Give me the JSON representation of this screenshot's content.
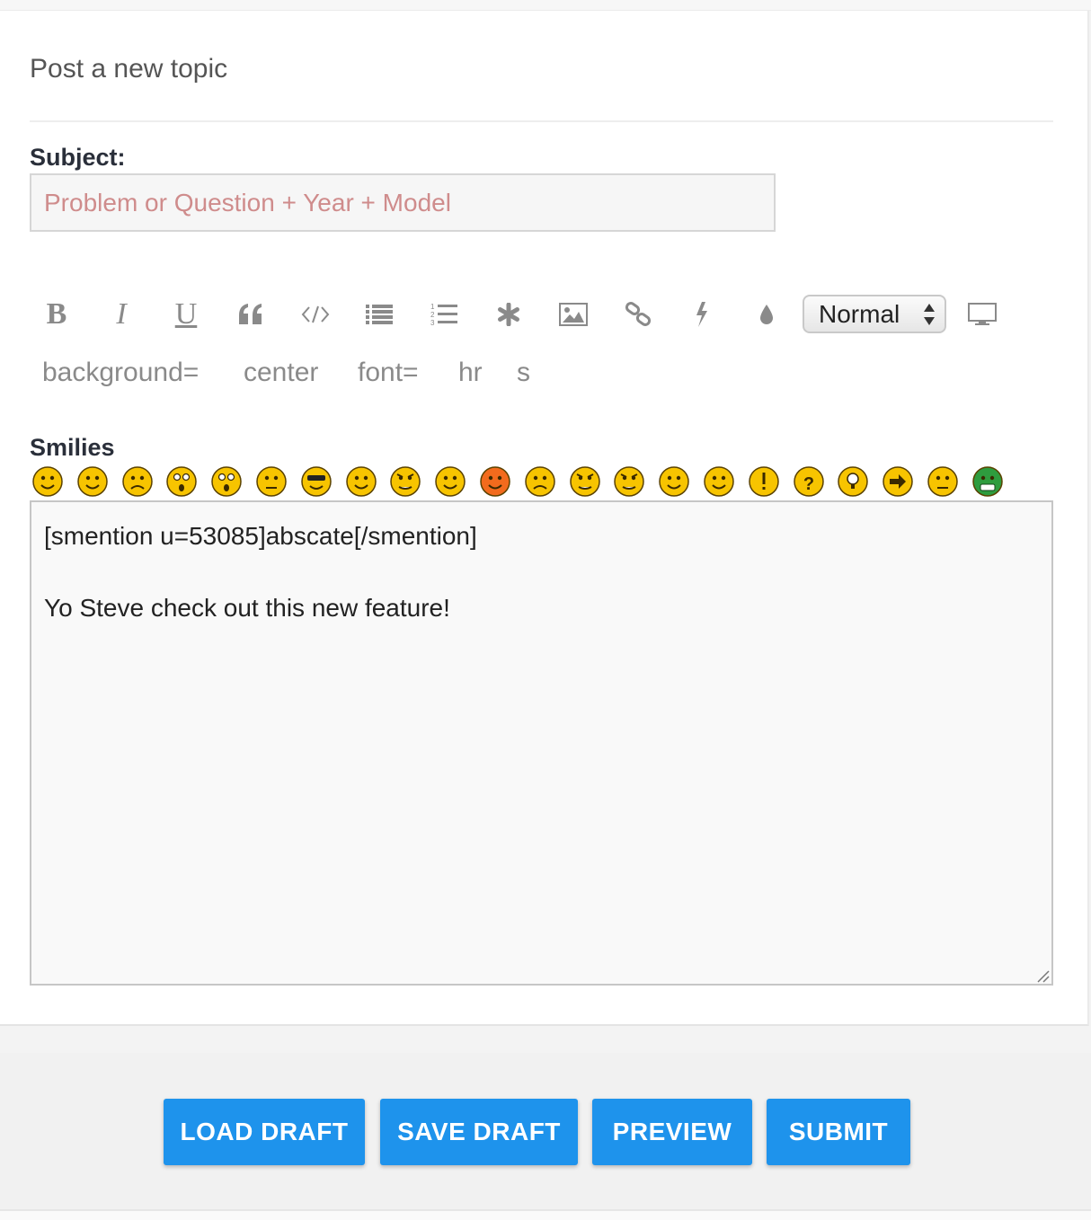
{
  "page": {
    "title": "Post a new topic"
  },
  "subject": {
    "label": "Subject:",
    "placeholder": "Problem or Question + Year + Model",
    "value": ""
  },
  "toolbar": {
    "buttons": [
      {
        "name": "bold",
        "icon": "bold-icon",
        "glyph": "B"
      },
      {
        "name": "italic",
        "icon": "italic-icon",
        "glyph": "I"
      },
      {
        "name": "underline",
        "icon": "underline-icon",
        "glyph": "U"
      },
      {
        "name": "quote",
        "icon": "quote-icon"
      },
      {
        "name": "code",
        "icon": "code-icon"
      },
      {
        "name": "bulleted-list",
        "icon": "bulleted-list-icon"
      },
      {
        "name": "numbered-list",
        "icon": "numbered-list-icon"
      },
      {
        "name": "list-item",
        "icon": "asterisk-icon"
      },
      {
        "name": "image",
        "icon": "image-icon"
      },
      {
        "name": "link",
        "icon": "link-icon"
      },
      {
        "name": "flash",
        "icon": "lightning-icon"
      },
      {
        "name": "color",
        "icon": "droplet-icon"
      }
    ],
    "font_size": {
      "selected": "Normal"
    },
    "extra_icon": "monitor-icon"
  },
  "bbcodes": [
    "background=",
    "center",
    "font=",
    "hr",
    "s"
  ],
  "smilies": {
    "label": "Smilies",
    "items": [
      "very-happy",
      "smile",
      "sad",
      "surprised",
      "shocked",
      "confused",
      "cool",
      "laughing",
      "mad",
      "razz",
      "embarrassed",
      "crying",
      "evil",
      "twisted-evil",
      "rolling-eyes",
      "wink",
      "exclamation",
      "question",
      "idea",
      "arrow",
      "neutral",
      "mr-green"
    ],
    "colors": {
      "yellow": "#f7c400",
      "orange": "#f26b1d",
      "green": "#2e9c3e",
      "outline": "#5a4200"
    }
  },
  "message": {
    "line1": "[smention u=53085]abscate[/smention]",
    "line2": "",
    "line3": "Yo Steve check out this new feature!"
  },
  "footer": {
    "load_draft": "LOAD DRAFT",
    "save_draft": "SAVE DRAFT",
    "preview": "PREVIEW",
    "submit": "SUBMIT"
  },
  "colors": {
    "accent": "#1e93ec",
    "placeholder": "#cf8c8c"
  }
}
